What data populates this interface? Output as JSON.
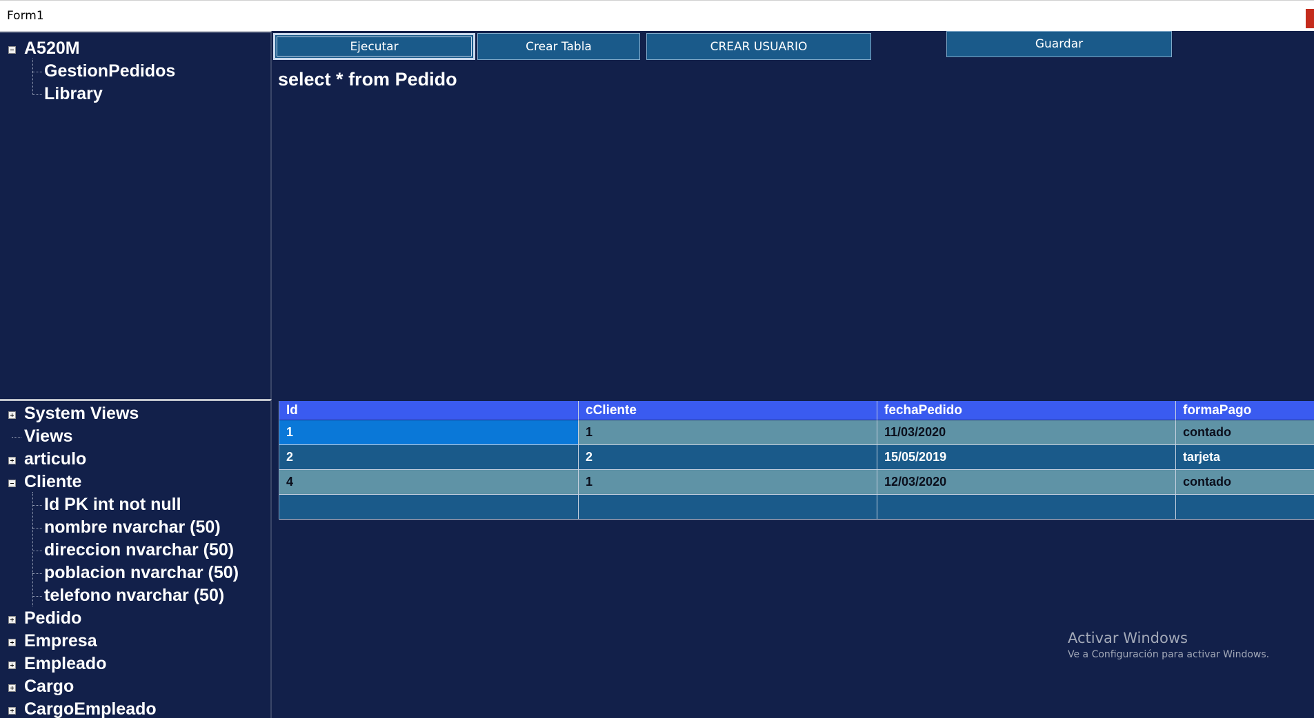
{
  "window": {
    "title": "Form1"
  },
  "toolbar": {
    "ejecutar_label": "Ejecutar",
    "crear_tabla_label": "Crear Tabla",
    "crear_usuario_label": "CREAR USUARIO",
    "guardar_label": "Guardar"
  },
  "query_text": "select * from Pedido",
  "tree_top": {
    "root": "A520M",
    "children": [
      "GestionPedidos",
      "Library"
    ]
  },
  "tree_bottom": {
    "system_views": "System Views",
    "views": "Views",
    "articulo": "articulo",
    "cliente": "Cliente",
    "cliente_columns": [
      "Id  PK   int not null",
      "nombre nvarchar (50)",
      "direccion nvarchar (50)",
      "poblacion nvarchar (50)",
      "telefono nvarchar (50)"
    ],
    "pedido": "Pedido",
    "empresa": "Empresa",
    "empleado": "Empleado",
    "cargo": "Cargo",
    "cargo_empleado": "CargoEmpleado"
  },
  "grid": {
    "columns": [
      "Id",
      "cCliente",
      "fechaPedido",
      "formaPago"
    ],
    "rows": [
      [
        "1",
        "1",
        "11/03/2020",
        "contado"
      ],
      [
        "2",
        "2",
        "15/05/2019",
        "tarjeta"
      ],
      [
        "4",
        "1",
        "12/03/2020",
        "contado"
      ]
    ]
  },
  "watermark": {
    "line1": "Activar Windows",
    "line2": "Ve a Configuración para activar Windows."
  }
}
